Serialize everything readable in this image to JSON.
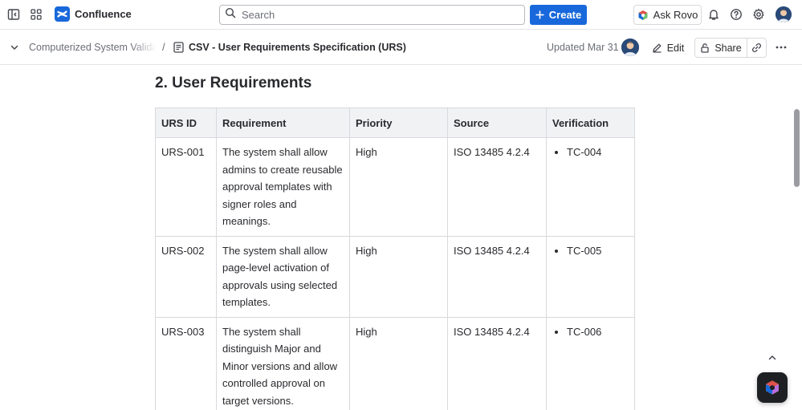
{
  "topnav": {
    "app_name": "Confluence",
    "search_placeholder": "Search",
    "create_label": "Create",
    "ask_rovo_label": "Ask Rovo"
  },
  "page_header": {
    "parent_crumb": "Computerized System Validation",
    "current_page": "CSV - User Requirements Specification (URS)",
    "updated": "Updated Mar 31",
    "edit_label": "Edit",
    "share_label": "Share",
    "breadcrumb_separator": "/"
  },
  "content": {
    "heading": "2. User Requirements",
    "table": {
      "headers": [
        "URS ID",
        "Requirement",
        "Priority",
        "Source",
        "Verification"
      ],
      "rows": [
        {
          "id": "URS-001",
          "requirement": "The system shall allow admins to create reusable approval templates with signer roles and meanings.",
          "priority": "High",
          "source": "ISO 13485 4.2.4",
          "verification": "TC-004"
        },
        {
          "id": "URS-002",
          "requirement": "The system shall allow page-level activation of approvals using selected templates.",
          "priority": "High",
          "source": "ISO 13485 4.2.4",
          "verification": "TC-005"
        },
        {
          "id": "URS-003",
          "requirement": "The system shall distinguish Major and Minor versions and allow controlled approval on target versions.",
          "priority": "High",
          "source": "ISO 13485 4.2.4",
          "verification": "TC-006"
        }
      ]
    }
  },
  "colors": {
    "primary": "#1868db",
    "header_bg": "#f1f2f4",
    "border": "#d8d9dd",
    "text": "#292a2e",
    "subtle_text": "#6b6e76"
  },
  "icons": {
    "sidebar_toggle": "sidebar-toggle-icon",
    "app_switcher": "app-switcher-icon",
    "logo": "confluence-logo-icon",
    "search": "search-icon",
    "create_plus": "plus-icon",
    "rovo": "rovo-icon",
    "notifications": "bell-icon",
    "help": "help-icon",
    "settings": "gear-icon",
    "collapse": "chevron-down-icon",
    "page": "page-icon",
    "edit": "pencil-icon",
    "share": "lock-icon",
    "copy_link": "link-icon",
    "more": "more-icon",
    "scroll_top": "chevron-up-icon"
  }
}
